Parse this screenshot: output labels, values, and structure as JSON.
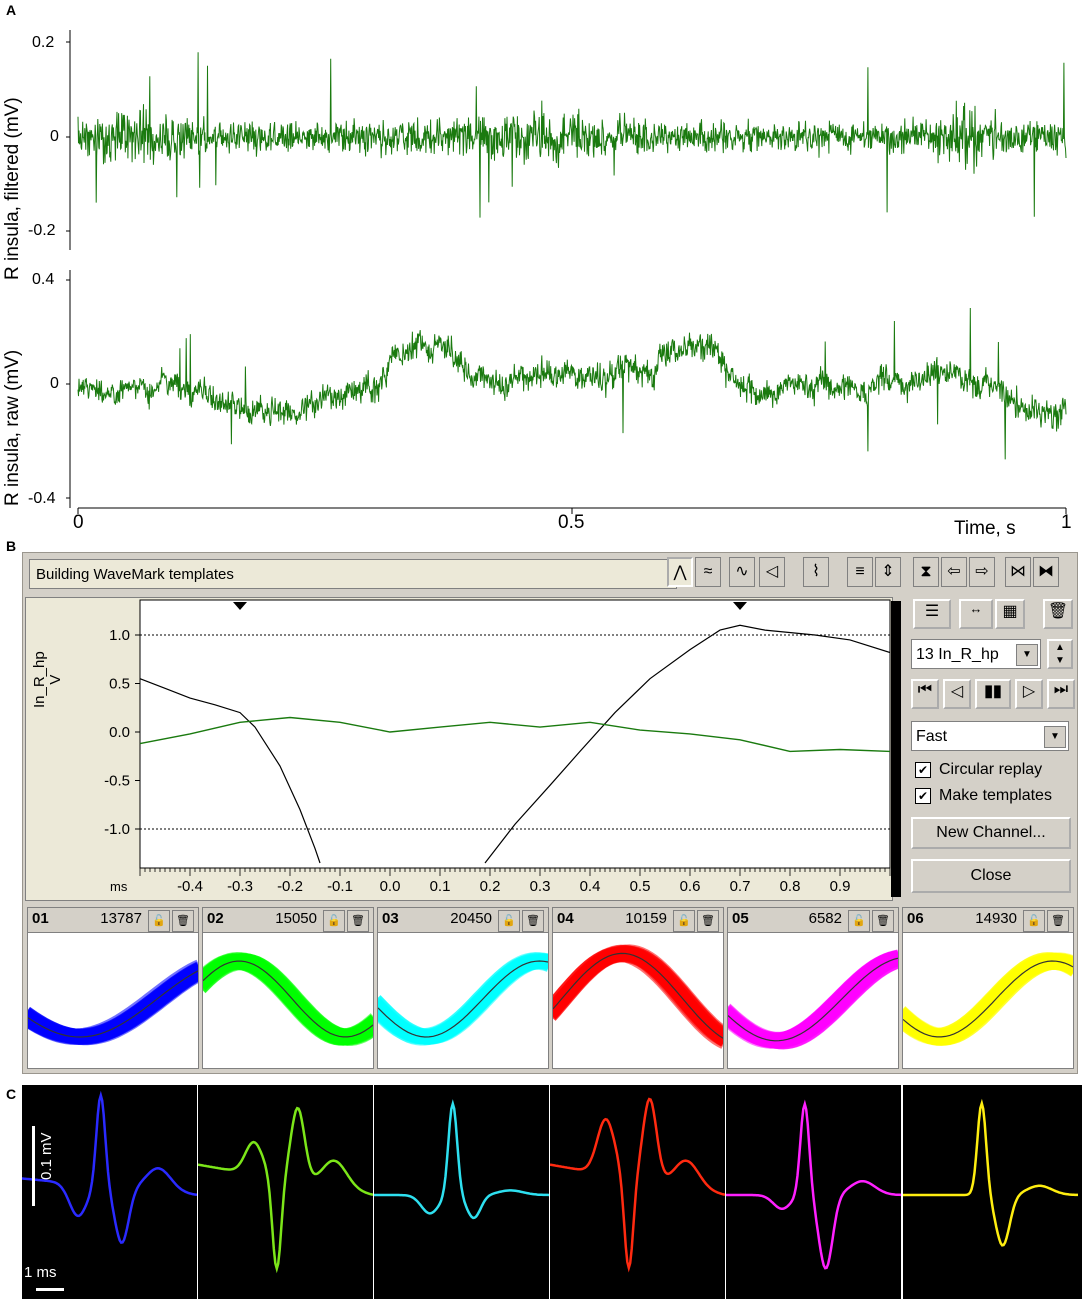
{
  "panel_labels": {
    "a": "A",
    "b": "B",
    "c": "C"
  },
  "panelA": {
    "top_ylabel": "R insula, filtered (mV)",
    "bottom_ylabel": "R insula, raw (mV)",
    "top_ticks": [
      "0.2",
      "0",
      "-0.2"
    ],
    "bottom_ticks": [
      "0.4",
      "0",
      "-0.4"
    ],
    "x_ticks": [
      "0",
      "0.5",
      "1"
    ],
    "x_label": "Time, s",
    "trace_color": "#1a7a0f"
  },
  "panelB": {
    "status_text": "Building WaveMark templates",
    "ylabel_line1": "In_R_hp",
    "ylabel_line2": "V",
    "y_ticks": [
      "1.0",
      "0.5",
      "0.0",
      "-0.5",
      "-1.0"
    ],
    "x_unit": "ms",
    "x_ticks": [
      "-0.4",
      "-0.3",
      "-0.2",
      "-0.1",
      "0.0",
      "0.1",
      "0.2",
      "0.3",
      "0.4",
      "0.5",
      "0.6",
      "0.7",
      "0.8",
      "0.9"
    ],
    "channel_select": "13 In_R_hp",
    "speed_select": "Fast",
    "circular_replay": "Circular replay",
    "make_templates": "Make templates",
    "new_channel": "New Channel...",
    "close": "Close",
    "templates": [
      {
        "id": "01",
        "count": "13787",
        "color": "#0000ff"
      },
      {
        "id": "02",
        "count": "15050",
        "color": "#00ff00"
      },
      {
        "id": "03",
        "count": "20450",
        "color": "#00ffff"
      },
      {
        "id": "04",
        "count": "10159",
        "color": "#ff0000"
      },
      {
        "id": "05",
        "count": "6582",
        "color": "#ff00ff"
      },
      {
        "id": "06",
        "count": "14930",
        "color": "#ffff00"
      }
    ]
  },
  "panelC": {
    "scale_voltage": "0.1 mV",
    "scale_time": "1 ms",
    "colors": [
      "#2a2aff",
      "#7ce619",
      "#2ee0f0",
      "#ff2a10",
      "#ff20ff",
      "#ffee10"
    ]
  }
}
